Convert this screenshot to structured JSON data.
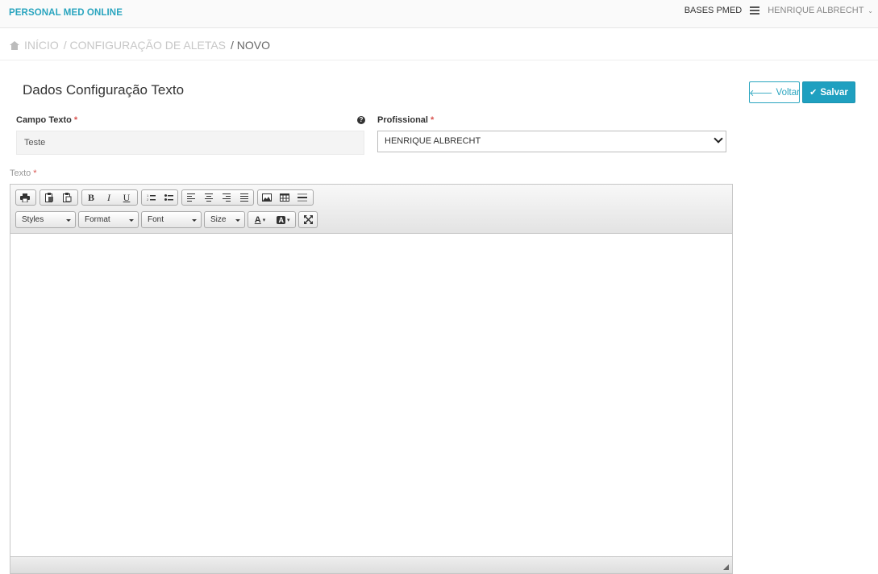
{
  "header": {
    "brand": "PERSONAL MED ONLINE",
    "bases_label": "BASES PMED",
    "user_name": "HENRIQUE ALBRECHT"
  },
  "breadcrumb": {
    "home": "INÍCIO",
    "config": "/ CONFIGURAÇÃO DE ALETAS",
    "current": "/ NOVO"
  },
  "page": {
    "title": "Dados Configuração Texto",
    "back_label": "Voltar",
    "save_label": "Salvar"
  },
  "form": {
    "campo_texto_label": "Campo Texto",
    "campo_texto_value": "Teste",
    "profissional_label": "Profissional",
    "profissional_value": "HENRIQUE ALBRECHT",
    "texto_label": "Texto",
    "required_mark": "*"
  },
  "editor": {
    "styles_label": "Styles",
    "format_label": "Format",
    "font_label": "Font",
    "size_label": "Size",
    "bold": "B",
    "italic": "I",
    "underline": "U",
    "text_color_label": "A",
    "bg_color_label": "A"
  },
  "colors": {
    "accent": "#2aa5bf",
    "save_bg": "#1fa0c0",
    "required": "#d9534f"
  }
}
